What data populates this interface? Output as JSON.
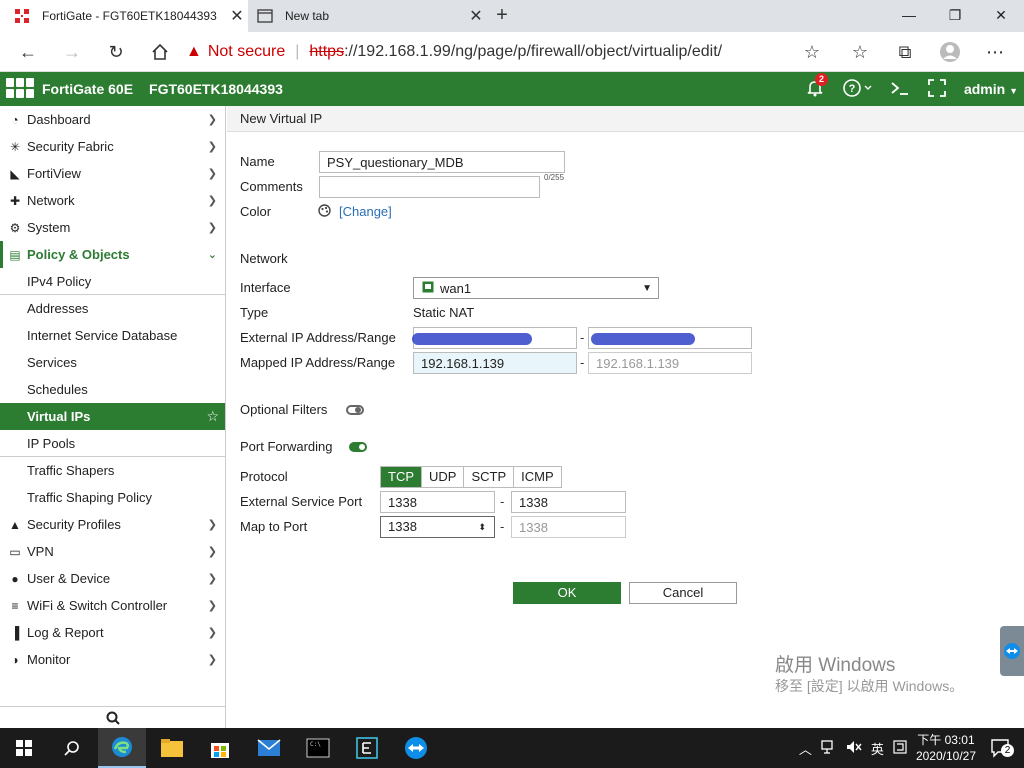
{
  "browser": {
    "tabs": [
      {
        "title": "FortiGate - FGT60ETK18044393",
        "active": true
      },
      {
        "title": "New tab",
        "active": false
      }
    ],
    "new_tab": "+",
    "not_secure": "Not secure",
    "url_protocol": "https",
    "url_rest": "://192.168.1.99/ng/page/p/firewall/object/virtualip/edit/"
  },
  "header": {
    "model": "FortiGate 60E",
    "serial": "FGT60ETK18044393",
    "notification_count": "2",
    "user": "admin"
  },
  "sidebar": {
    "items": [
      {
        "label": "Dashboard",
        "icon": "dashboard-icon",
        "glyph": "◔"
      },
      {
        "label": "Security Fabric",
        "icon": "security-fabric-icon",
        "glyph": "✳"
      },
      {
        "label": "FortiView",
        "icon": "chart-icon",
        "glyph": "◣"
      },
      {
        "label": "Network",
        "icon": "network-icon",
        "glyph": "✚"
      },
      {
        "label": "System",
        "icon": "gear-icon",
        "glyph": "⚙"
      },
      {
        "label": "Policy & Objects",
        "icon": "document-icon",
        "glyph": "▤"
      }
    ],
    "sub_items": [
      {
        "label": "IPv4 Policy"
      },
      {
        "label": "Addresses"
      },
      {
        "label": "Internet Service Database"
      },
      {
        "label": "Services"
      },
      {
        "label": "Schedules"
      },
      {
        "label": "Virtual IPs"
      },
      {
        "label": "IP Pools"
      },
      {
        "label": "Traffic Shapers"
      },
      {
        "label": "Traffic Shaping Policy"
      }
    ],
    "items_after": [
      {
        "label": "Security Profiles",
        "icon": "lock-icon",
        "glyph": "▲"
      },
      {
        "label": "VPN",
        "icon": "monitor-icon",
        "glyph": "▭"
      },
      {
        "label": "User & Device",
        "icon": "user-icon",
        "glyph": "●"
      },
      {
        "label": "WiFi & Switch Controller",
        "icon": "wifi-icon",
        "glyph": "≡"
      },
      {
        "label": "Log & Report",
        "icon": "bar-chart-icon",
        "glyph": "▐"
      },
      {
        "label": "Monitor",
        "icon": "pie-icon",
        "glyph": "◑"
      }
    ]
  },
  "page": {
    "title": "New Virtual IP",
    "name_label": "Name",
    "name_value": "PSY_questionary_MDB",
    "comments_label": "Comments",
    "comments_counter": "0/255",
    "color_label": "Color",
    "color_change": "[Change]",
    "network_section": "Network",
    "interface_label": "Interface",
    "interface_value": "wan1",
    "type_label": "Type",
    "type_value": "Static NAT",
    "ext_ip_label": "External IP Address/Range",
    "mapped_ip_label": "Mapped IP Address/Range",
    "mapped_ip_start": "192.168.1.139",
    "mapped_ip_end": "192.168.1.139",
    "range_sep": "-",
    "optional_filters_label": "Optional Filters",
    "port_forwarding_label": "Port Forwarding",
    "protocol_label": "Protocol",
    "protocols": [
      "TCP",
      "UDP",
      "SCTP",
      "ICMP"
    ],
    "ext_port_label": "External Service Port",
    "ext_port_start": "1338",
    "ext_port_end": "1338",
    "map_port_label": "Map to Port",
    "map_port_start": "1338",
    "map_port_end": "1338",
    "ok_label": "OK",
    "cancel_label": "Cancel"
  },
  "watermark": {
    "line1": "啟用 Windows",
    "line2": "移至 [設定] 以啟用 Windows。"
  },
  "taskbar": {
    "ime": "英",
    "time": "下午 03:01",
    "date": "2020/10/27",
    "notif_count": "2"
  },
  "colors": {
    "forti_green": "#2c7c32",
    "not_secure_red": "#cc0000"
  }
}
